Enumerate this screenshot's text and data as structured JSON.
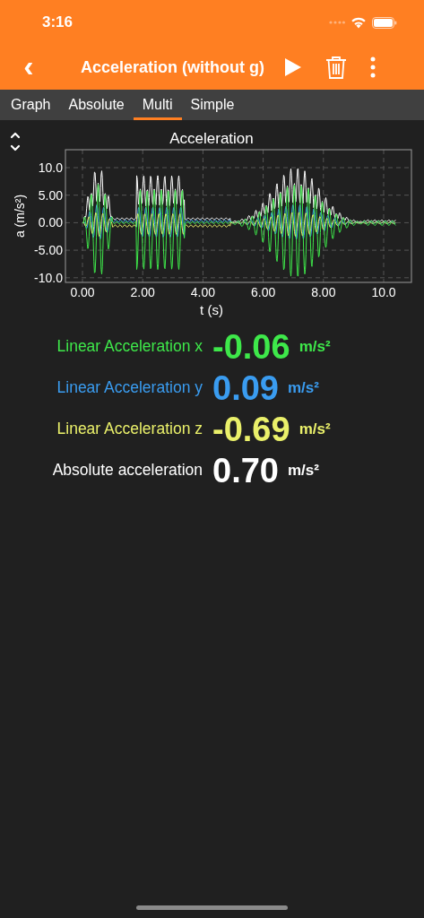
{
  "status_bar": {
    "time": "3:16"
  },
  "nav_bar": {
    "back": "‹",
    "title": "Acceleration (without g)"
  },
  "tabs": [
    {
      "label": "Graph",
      "selected": false
    },
    {
      "label": "Absolute",
      "selected": false
    },
    {
      "label": "Multi",
      "selected": true
    },
    {
      "label": "Simple",
      "selected": false
    }
  ],
  "graph": {
    "title": "Acceleration",
    "xlabel": "t (s)",
    "ylabel": "a (m/s²)",
    "yticks": [
      "10.0",
      "5.00",
      "0.00",
      "-5.00",
      "-10.0"
    ],
    "xticks": [
      "0.00",
      "2.00",
      "4.00",
      "6.00",
      "8.00",
      "10.0"
    ]
  },
  "readings": [
    {
      "label": "Linear Acceleration x",
      "value": "-0.06",
      "unit": "m/s²",
      "color": "#3ee84a"
    },
    {
      "label": "Linear Acceleration y",
      "value": "0.09",
      "unit": "m/s²",
      "color": "#3a9cf0"
    },
    {
      "label": "Linear Acceleration z",
      "value": "-0.69",
      "unit": "m/s²",
      "color": "#eaf06a"
    },
    {
      "label": "Absolute acceleration",
      "value": "0.70",
      "unit": "m/s²",
      "color": "#ffffff"
    }
  ]
}
